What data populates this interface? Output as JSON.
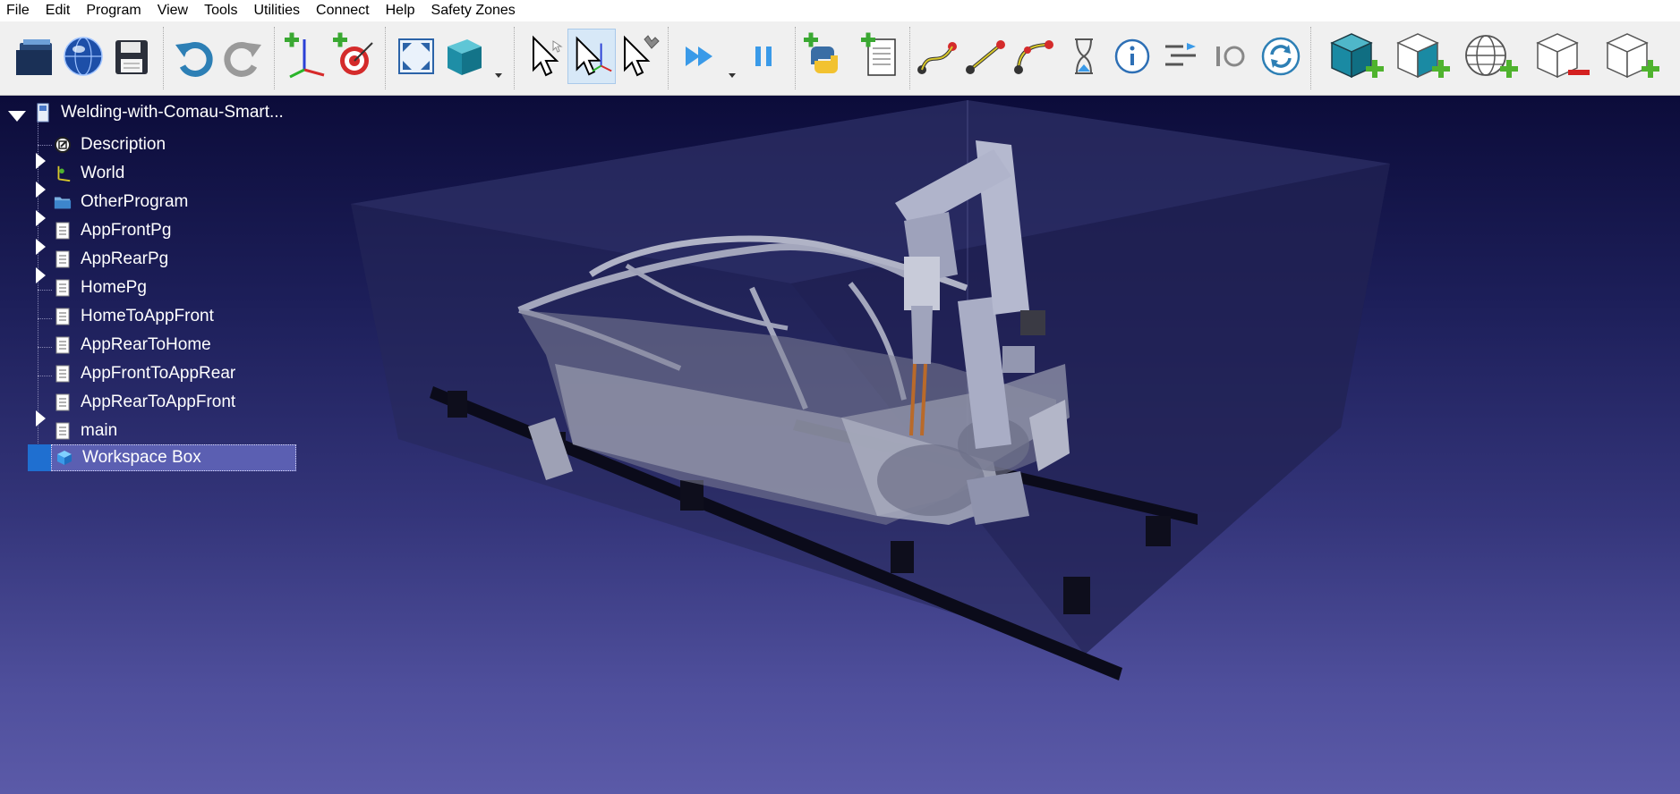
{
  "menu": [
    "File",
    "Edit",
    "Program",
    "View",
    "Tools",
    "Utilities",
    "Connect",
    "Help",
    "Safety Zones"
  ],
  "toolbar": {
    "buttons": [
      {
        "name": "open-icon"
      },
      {
        "name": "online-library-icon"
      },
      {
        "name": "save-icon"
      },
      {
        "name": "undo-icon"
      },
      {
        "name": "redo-icon"
      },
      {
        "name": "add-reference-frame-icon"
      },
      {
        "name": "add-target-icon"
      },
      {
        "name": "fit-all-icon"
      },
      {
        "name": "view-cube-icon"
      },
      {
        "name": "select-icon"
      },
      {
        "name": "move-reference-icon"
      },
      {
        "name": "move-tcp-icon"
      },
      {
        "name": "run-simulation-icon"
      },
      {
        "name": "pause-icon"
      },
      {
        "name": "add-python-program-icon"
      },
      {
        "name": "add-program-icon"
      },
      {
        "name": "move-joint-icon"
      },
      {
        "name": "move-linear-icon"
      },
      {
        "name": "move-circular-icon"
      },
      {
        "name": "pause-instruction-icon"
      },
      {
        "name": "message-icon"
      },
      {
        "name": "program-call-icon"
      },
      {
        "name": "set-io-icon"
      },
      {
        "name": "refresh-icon"
      },
      {
        "name": "add-safety-box-icon"
      },
      {
        "name": "add-safety-plane-icon"
      },
      {
        "name": "add-safety-sphere-icon"
      },
      {
        "name": "remove-safety-zone-icon"
      },
      {
        "name": "add-safety-zone-icon"
      }
    ]
  },
  "tree": {
    "root": "Welding-with-Comau-Smart...",
    "items": [
      {
        "label": "Description",
        "icon": "description-icon",
        "expandable": false
      },
      {
        "label": "World",
        "icon": "world-frame-icon",
        "expandable": true
      },
      {
        "label": "OtherProgram",
        "icon": "folder-icon",
        "expandable": true
      },
      {
        "label": "AppFrontPg",
        "icon": "program-icon",
        "expandable": true
      },
      {
        "label": "AppRearPg",
        "icon": "program-icon",
        "expandable": true
      },
      {
        "label": "HomePg",
        "icon": "program-icon",
        "expandable": true
      },
      {
        "label": "HomeToAppFront",
        "icon": "program-icon",
        "expandable": false
      },
      {
        "label": "AppRearToHome",
        "icon": "program-icon",
        "expandable": false
      },
      {
        "label": "AppFrontToAppRear",
        "icon": "program-icon",
        "expandable": false
      },
      {
        "label": "AppRearToAppFront",
        "icon": "program-icon",
        "expandable": false
      },
      {
        "label": "main",
        "icon": "program-icon",
        "expandable": true
      },
      {
        "label": "Workspace Box",
        "icon": "box-object-icon",
        "expandable": false,
        "selected": true
      }
    ]
  },
  "colors": {
    "accent": "#1f6fd0",
    "viewport_top": "#0c0c3a",
    "viewport_bottom": "#5b5aa8"
  }
}
